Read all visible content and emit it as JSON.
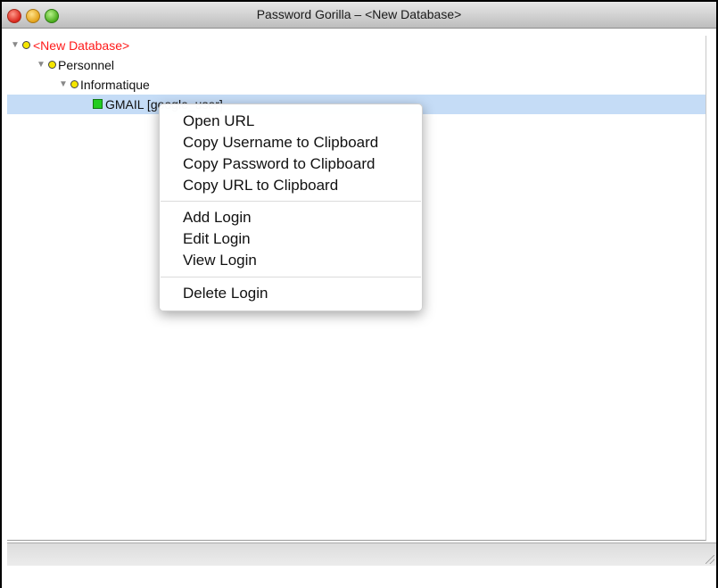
{
  "window": {
    "title": "Password Gorilla – <New Database>"
  },
  "tree": {
    "root": "<New Database>",
    "group": "Personnel",
    "subgroup": "Informatique",
    "entry": "GMAIL [google_user]"
  },
  "context_menu": {
    "items": [
      "Open URL",
      "Copy Username to Clipboard",
      "Copy Password to Clipboard",
      "Copy URL to Clipboard",
      "Add Login",
      "Edit Login",
      "View Login",
      "Delete Login"
    ]
  },
  "colors": {
    "root_text": "#ff1a1a",
    "selection": "#c5dcf6",
    "group_marker": "#f5e600",
    "entry_marker": "#22cc22"
  },
  "icons": {
    "disclosure": "triangle-down-icon",
    "group": "group-circle-icon",
    "entry": "entry-square-icon"
  }
}
